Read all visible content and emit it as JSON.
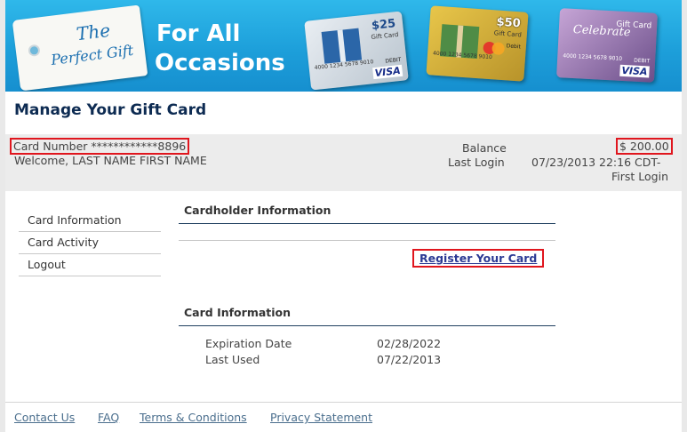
{
  "banner": {
    "logo_line1": "The",
    "logo_line2": "Perfect Gift",
    "slogan_line1": "For All",
    "slogan_line2": "Occasions",
    "card1_amount": "$25",
    "card1_label": "Gift Card",
    "card1_number": "4000 1234 5678 9010",
    "card1_brand": "VISA",
    "card1_type": "DEBIT",
    "card2_amount": "$50",
    "card2_label": "Gift Card",
    "card2_number": "4000 1234 5678 9010",
    "card2_type": "Debit",
    "card3_script": "Celebrate",
    "card3_label": "Gift Card",
    "card3_number": "4000 1234 5678 9010",
    "card3_brand": "VISA",
    "card3_type": "DEBIT"
  },
  "page_title": "Manage Your Gift Card",
  "account": {
    "card_number_label": "Card Number",
    "card_number_value": "************8896",
    "welcome": "Welcome, LAST NAME FIRST NAME",
    "balance_label": "Balance",
    "balance_value": "$ 200.00",
    "last_login_label": "Last Login",
    "last_login_value_line1": "07/23/2013 22:16 CDT-",
    "last_login_value_line2": "First Login"
  },
  "sidebar": {
    "items": [
      {
        "label": "Card Information"
      },
      {
        "label": "Card Activity"
      },
      {
        "label": "Logout"
      }
    ]
  },
  "main": {
    "cardholder_heading": "Cardholder Information",
    "register_link": "Register Your Card",
    "card_info_heading": "Card Information",
    "details": [
      {
        "label": "Expiration Date",
        "value": "02/28/2022"
      },
      {
        "label": "Last Used",
        "value": "07/22/2013"
      }
    ]
  },
  "footer": {
    "links": [
      "Contact Us",
      "FAQ",
      "Terms & Conditions",
      "Privacy Statement"
    ]
  },
  "colors": {
    "banner_blue": "#1d9fda",
    "title_navy": "#0d2b52",
    "highlight_red": "#e0161e",
    "link_blue": "#2c3a94"
  }
}
